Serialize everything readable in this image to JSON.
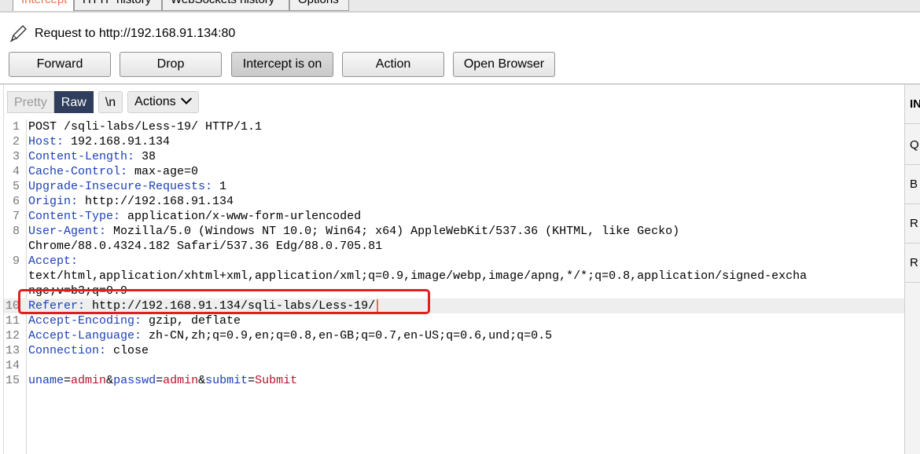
{
  "tabs": [
    {
      "label": "Intercept",
      "active": true
    },
    {
      "label": "HTTP history",
      "active": false
    },
    {
      "label": "WebSockets history",
      "active": false
    },
    {
      "label": "Options",
      "active": false
    }
  ],
  "request_line": "Request to http://192.168.91.134:80",
  "buttons": {
    "forward": "Forward",
    "drop": "Drop",
    "intercept": "Intercept is on",
    "action": "Action",
    "open_browser": "Open Browser"
  },
  "editor_toolbar": {
    "pretty": "Pretty",
    "raw": "Raw",
    "newline": "\\n",
    "actions": "Actions"
  },
  "lines": [
    {
      "n": "1",
      "text": "POST /sqli-labs/Less-19/ HTTP/1.1"
    },
    {
      "n": "2",
      "key": "Host:",
      "val": " 192.168.91.134"
    },
    {
      "n": "3",
      "key": "Content-Length:",
      "val": " 38"
    },
    {
      "n": "4",
      "key": "Cache-Control:",
      "val": " max-age=0"
    },
    {
      "n": "5",
      "key": "Upgrade-Insecure-Requests:",
      "val": " 1"
    },
    {
      "n": "6",
      "key": "Origin:",
      "val": " http://192.168.91.134"
    },
    {
      "n": "7",
      "key": "Content-Type:",
      "val": " application/x-www-form-urlencoded"
    },
    {
      "n": "8",
      "key": "User-Agent:",
      "val": " Mozilla/5.0 (Windows NT 10.0; Win64; x64) AppleWebKit/537.36 (KHTML, like Gecko)"
    },
    {
      "n": "",
      "text": "Chrome/88.0.4324.182 Safari/537.36 Edg/88.0.705.81"
    },
    {
      "n": "9",
      "key": "Accept:",
      "val": ""
    },
    {
      "n": "",
      "text": "text/html,application/xhtml+xml,application/xml;q=0.9,image/webp,image/apng,*/*;q=0.8,application/signed-excha"
    },
    {
      "n": "",
      "text": "nge;v=b3;q=0.9"
    },
    {
      "n": "10",
      "key": "Referer:",
      "val": " http://192.168.91.134/sqli-labs/Less-19/"
    },
    {
      "n": "11",
      "key": "Accept-Encoding:",
      "val": " gzip, deflate"
    },
    {
      "n": "12",
      "key": "Accept-Language:",
      "val": " zh-CN,zh;q=0.9,en;q=0.8,en-GB;q=0.7,en-US;q=0.6,und;q=0.5"
    },
    {
      "n": "13",
      "key": "Connection:",
      "val": " close"
    },
    {
      "n": "14",
      "text": ""
    }
  ],
  "body_params": {
    "n": "15",
    "k1": "uname",
    "v1": "admin",
    "amp1": "&",
    "k2": "passwd",
    "v2": "admin",
    "amp2": "&",
    "k3": "submit",
    "v3": "Submit",
    "eq": "="
  },
  "inspector": {
    "title": "IN",
    "rows": [
      "Q",
      "B",
      "R",
      "R"
    ]
  },
  "colors": {
    "header_key": "#1c3fb5",
    "param_value": "#b3122a",
    "raw_active_bg": "#2f3e5c",
    "highlight_box": "#e02020",
    "tab_active_text": "#e8734a"
  },
  "icons": {
    "request": "pencil-icon",
    "actions": "chevron-down-icon"
  }
}
